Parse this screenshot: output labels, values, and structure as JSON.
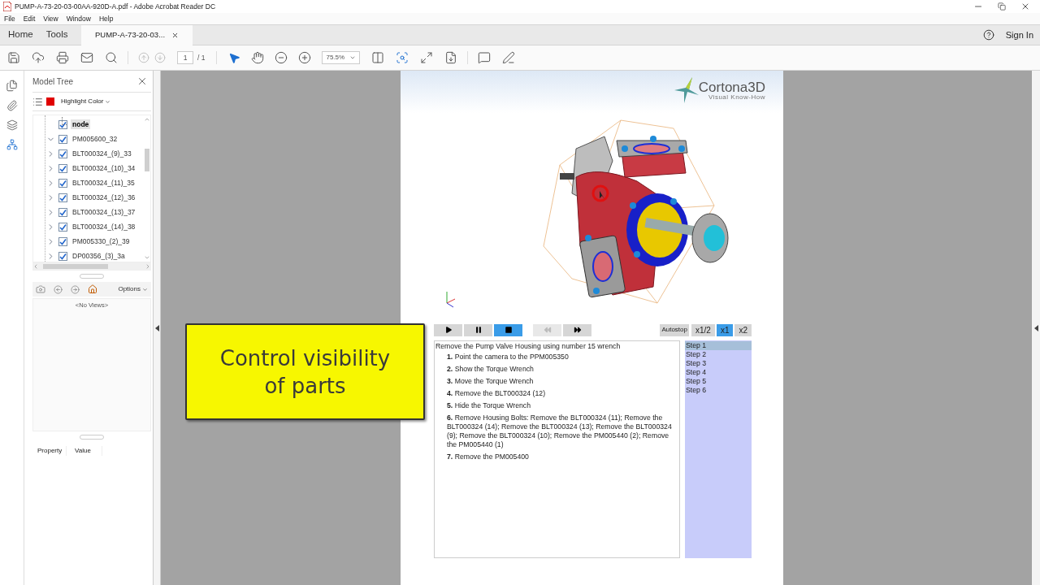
{
  "window": {
    "title": "PUMP-A-73-20-03-00AA-920D-A.pdf - Adobe Acrobat Reader DC"
  },
  "menu": [
    "File",
    "Edit",
    "View",
    "Window",
    "Help"
  ],
  "nav_tabs": [
    {
      "label": "Home",
      "selected": false
    },
    {
      "label": "Tools",
      "selected": false
    }
  ],
  "document_tab": {
    "label": "PUMP-A-73-20-03...",
    "selected": true
  },
  "sign_in": "Sign In",
  "toolbar": {
    "page": "1",
    "page_count": "/ 1",
    "zoom": "75.5%"
  },
  "model_tree": {
    "title": "Model Tree",
    "highlight_label": "Highlight Color",
    "items": [
      {
        "expanded": true,
        "children": [
          {
            "label": "node",
            "checked": true,
            "selected": true
          }
        ]
      },
      {
        "label": "PM005600_32",
        "checked": true,
        "expanded": true,
        "selected": false,
        "children": [
          {
            "label": "BLT000324_(9)_33",
            "checked": true,
            "expanded": false,
            "selected": false
          },
          {
            "label": "BLT000324_(10)_34",
            "checked": true,
            "expanded": false,
            "selected": false
          },
          {
            "label": "BLT000324_(11)_35",
            "checked": true,
            "expanded": false,
            "selected": false
          },
          {
            "label": "BLT000324_(12)_36",
            "checked": true,
            "expanded": false,
            "selected": false
          },
          {
            "label": "BLT000324_(13)_37",
            "checked": true,
            "expanded": false,
            "selected": false
          },
          {
            "label": "BLT000324_(14)_38",
            "checked": true,
            "expanded": false,
            "selected": false
          },
          {
            "label": "PM005330_(2)_39",
            "checked": true,
            "expanded": false,
            "selected": false
          },
          {
            "label": "DP00356_(3)_3a",
            "checked": true,
            "expanded": false,
            "selected": false
          }
        ]
      }
    ],
    "options": "Options",
    "no_views": "<No Views>",
    "columns": [
      "Property",
      "Value"
    ]
  },
  "document": {
    "logo": {
      "name": "Cortona3D",
      "tagline": "Visual Know-How"
    },
    "playback": [
      {
        "kind": "play",
        "selected": false,
        "disabled": false
      },
      {
        "kind": "pause",
        "selected": false,
        "disabled": false
      },
      {
        "kind": "stop",
        "selected": true,
        "disabled": false
      },
      {
        "kind": "previous",
        "selected": false,
        "disabled": true
      },
      {
        "kind": "next",
        "selected": false,
        "disabled": false
      }
    ],
    "autostop": "Autostop",
    "speeds": [
      {
        "label": "x1/2",
        "selected": false
      },
      {
        "label": "x1",
        "selected": true
      },
      {
        "label": "x2",
        "selected": false
      }
    ],
    "intro": "Remove the Pump Valve Housing using number 15 wrench",
    "instructions": [
      {
        "number": "1.",
        "text": "Point the camera to the PPM005350"
      },
      {
        "number": "2.",
        "text": "Show the Torque Wrench"
      },
      {
        "number": "3.",
        "text": "Move the Torque Wrench"
      },
      {
        "number": "4.",
        "text": "Remove the BLT000324 (12)"
      },
      {
        "number": "5.",
        "text": "Hide the Torque Wrench"
      },
      {
        "number": "6.",
        "text": "Remove Housing Bolts: Remove the BLT000324 (11); Remove the BLT000324 (14); Remove the BLT000324 (13); Remove the BLT000324 (9); Remove the BLT000324 (10); Remove the PM005440 (2); Remove the PM005440 (1)"
      },
      {
        "number": "7.",
        "text": "Remove the PM005400"
      }
    ],
    "steps": [
      {
        "label": "Step 1",
        "selected": true
      },
      {
        "label": "Step 2",
        "selected": false
      },
      {
        "label": "Step 3",
        "selected": false
      },
      {
        "label": "Step 4",
        "selected": false
      },
      {
        "label": "Step 5",
        "selected": false
      },
      {
        "label": "Step 6",
        "selected": false
      }
    ]
  },
  "callout": "Control visibility of parts"
}
